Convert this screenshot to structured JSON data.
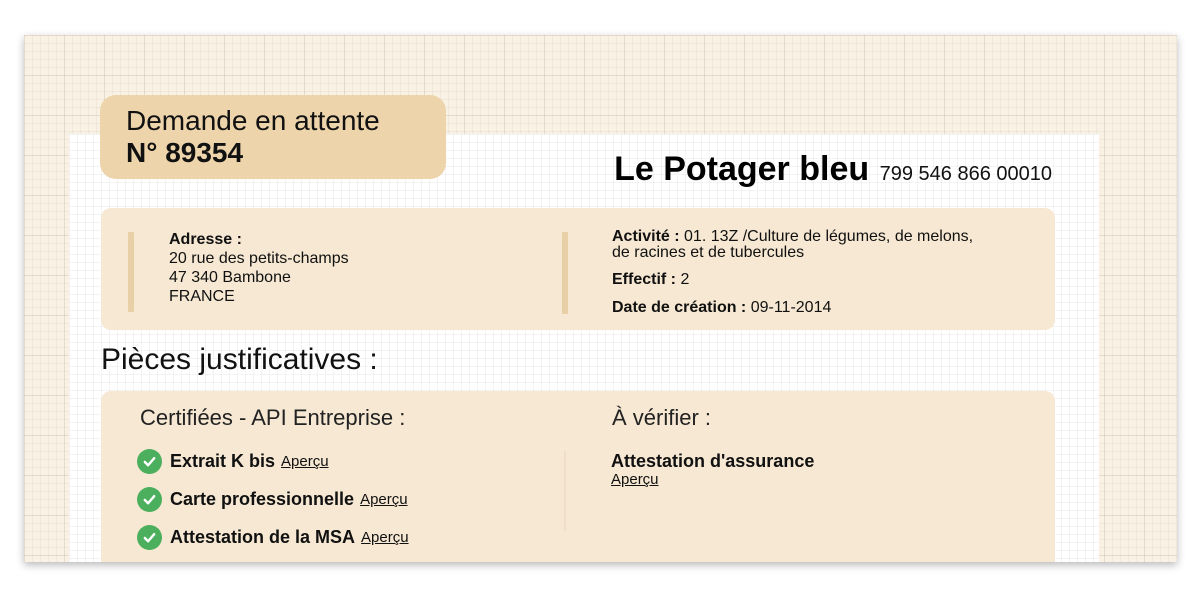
{
  "request": {
    "status": "Demande en attente",
    "number": "N° 89354"
  },
  "company": {
    "name": "Le Potager bleu",
    "siret": "799 546 866 00010"
  },
  "info": {
    "address_label": "Adresse :",
    "address_lines": [
      "20 rue des petits-champs",
      "47 340 Bambone",
      "FRANCE"
    ],
    "activity_label": "Activité :",
    "activity_lines": [
      "01. 13Z /Culture de légumes, de melons,",
      "de racines et de tubercules"
    ],
    "staff_label": "Effectif :",
    "staff_value": "2",
    "creation_label": "Date de création :",
    "creation_value": "09-11-2014"
  },
  "documents": {
    "title": "Pièces justificatives :",
    "certified_title": "Certifiées - API Entreprise :",
    "certified_items": [
      {
        "name": "Extrait K bis",
        "link": "Aperçu"
      },
      {
        "name": "Carte professionnelle",
        "link": "Aperçu"
      },
      {
        "name": "Attestation de la MSA",
        "link": "Aperçu"
      }
    ],
    "verify_title": "À vérifier :",
    "verify_items": [
      {
        "name": "Attestation d'assurance",
        "link": "Aperçu"
      }
    ]
  },
  "colors": {
    "accent_tan": "#edd4ab",
    "panel_bg": "#f6e8d2",
    "check_green": "#4caf5e"
  },
  "icons": {
    "certified": "check-circle-icon"
  }
}
